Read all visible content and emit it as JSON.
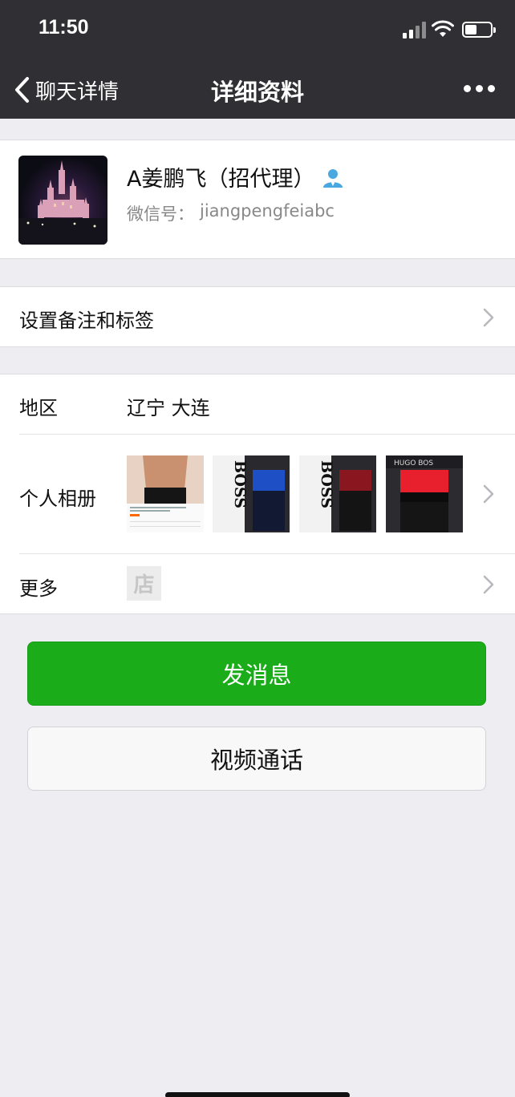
{
  "status_bar": {
    "time": "11:50"
  },
  "nav": {
    "back_label": "聊天详情",
    "title": "详细资料"
  },
  "profile": {
    "name": "A姜鹏飞（招代理）",
    "wechat_id_label": "微信号：",
    "wechat_id": "jiangpengfeiabc"
  },
  "rows": {
    "remark_label": "设置备注和标签",
    "region_label": "地区",
    "region_value": "辽宁 大连",
    "album_label": "个人相册",
    "more_label": "更多",
    "shop_icon_text": "店"
  },
  "album_photos": [
    {
      "name": "album-photo-model"
    },
    {
      "name": "album-photo-boss-blue",
      "brand": "BOSS"
    },
    {
      "name": "album-photo-boss-red",
      "brand": "BOSS"
    },
    {
      "name": "album-photo-hugo-boss-red",
      "brand": "HUGO BOSS"
    }
  ],
  "actions": {
    "send_message": "发消息",
    "video_call": "视频通话"
  },
  "colors": {
    "nav_background": "#2f2f34",
    "page_background": "#ededf2",
    "primary_button": "#1aad19",
    "badge_blue": "#4aa8e0"
  },
  "icons": {
    "back": "chevron-left-icon",
    "more": "more-dots-icon",
    "badge": "contact-badge-icon",
    "row_chevron": "chevron-right-icon"
  }
}
